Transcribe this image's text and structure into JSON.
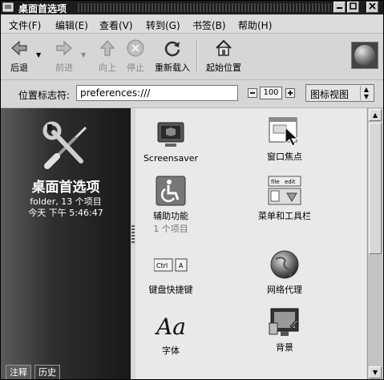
{
  "window": {
    "title": "桌面首选项"
  },
  "menubar": {
    "items": [
      "文件(F)",
      "编辑(E)",
      "查看(V)",
      "转到(G)",
      "书签(B)",
      "帮助(H)"
    ]
  },
  "toolbar": {
    "back": "后退",
    "forward": "前进",
    "up": "向上",
    "stop": "停止",
    "reload": "重新载入",
    "home": "起始位置"
  },
  "location": {
    "label": "位置标志符:",
    "value": "preferences:///",
    "zoom": "100",
    "view_mode": "图标视图"
  },
  "sidepane": {
    "title": "桌面首选项",
    "info": "folder, 13 个项目",
    "date": "今天 下午 5:46:47",
    "tabs": [
      "注释",
      "历史"
    ]
  },
  "items": [
    {
      "label": "Screensaver",
      "sublabel": ""
    },
    {
      "label": "窗口焦点",
      "sublabel": ""
    },
    {
      "label": "辅助功能",
      "sublabel": "1 个项目"
    },
    {
      "label": "菜单和工具栏",
      "sublabel": ""
    },
    {
      "label": "键盘快捷键",
      "sublabel": ""
    },
    {
      "label": "网络代理",
      "sublabel": ""
    },
    {
      "label": "字体",
      "sublabel": ""
    },
    {
      "label": "背景",
      "sublabel": ""
    }
  ],
  "icons": {
    "screensaver": "monitor-icon",
    "window_focus": "window-cursor-icon",
    "accessibility": "wheelchair-icon",
    "menus": "menu-toolbar-icon",
    "keyboard": "keyboard-keys-icon",
    "proxy": "globe-icon",
    "font": "font-icon",
    "background": "picture-icon"
  },
  "fonts_glyph": "Aa",
  "keycaps": [
    "Ctrl",
    "A"
  ],
  "menu_preview": [
    "file",
    "edit"
  ]
}
